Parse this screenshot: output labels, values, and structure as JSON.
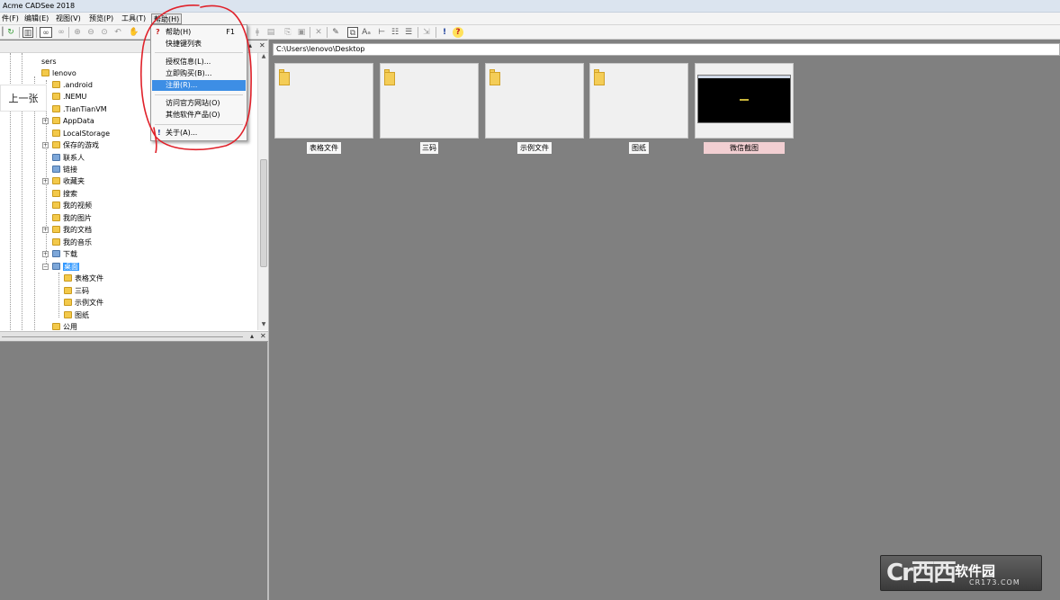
{
  "window": {
    "title": "Acme CADSee 2018"
  },
  "menubar": {
    "items": [
      {
        "label": "件(F)"
      },
      {
        "label": "编辑(E)"
      },
      {
        "label": "视图(V)"
      },
      {
        "label": "预览(P)"
      },
      {
        "label": "工具(T)"
      },
      {
        "label": "帮助(H)"
      }
    ]
  },
  "help_menu": {
    "items": [
      {
        "label": "帮助(H)",
        "shortcut": "F1",
        "icon": "question-icon"
      },
      {
        "label": "快捷键列表"
      },
      {
        "label": "授权信息(L)..."
      },
      {
        "label": "立即购买(B)..."
      },
      {
        "label": "注册(R)...",
        "highlighted": true
      },
      {
        "label": "访问官方网站(O)"
      },
      {
        "label": "其他软件产品(O)"
      },
      {
        "label": "关于(A)...",
        "icon": "exclamation-icon"
      }
    ]
  },
  "left_panel": {
    "prev_button": "上一张",
    "tree": {
      "root_partial": "sers",
      "user": "lenovo",
      "items": [
        ".android",
        ".NEMU",
        ".TianTianVM",
        "AppData",
        "LocalStorage",
        "保存的游戏",
        "联系人",
        "链接",
        "收藏夹",
        "搜索",
        "我的视频",
        "我的图片",
        "我的文档",
        "我的音乐",
        "下载",
        "桌面"
      ],
      "selected": "桌面",
      "desktop_children": [
        "表格文件",
        "三码",
        "示例文件",
        "图纸"
      ],
      "bottom_partial": "公用"
    }
  },
  "address": {
    "path": "C:\\Users\\lenovo\\Desktop"
  },
  "thumbnails": [
    {
      "label": "表格文件",
      "type": "folder"
    },
    {
      "label": "三码",
      "type": "folder"
    },
    {
      "label": "示例文件",
      "type": "folder"
    },
    {
      "label": "图纸",
      "type": "folder"
    },
    {
      "label": "微信截图",
      "type": "image",
      "selected": true
    }
  ],
  "watermark": {
    "logo": "Cr西西",
    "text": "软件园",
    "sub": "CR173.COM"
  },
  "colors": {
    "accent": "#3399ff",
    "menu_highlight": "#3d8ee5",
    "annotation": "#e0212a",
    "background": "#808080"
  }
}
